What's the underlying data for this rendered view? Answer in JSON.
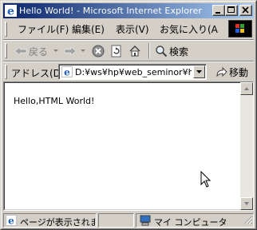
{
  "window": {
    "title": "Hello World! - Microsoft Internet Explorer"
  },
  "menu": {
    "items": [
      "ファイル(F)",
      "編集(E)",
      "表示(V)",
      "お気に入り(A"
    ]
  },
  "toolbar": {
    "back_label": "戻る",
    "search_label": "検索"
  },
  "address": {
    "label": "アドレス(D)",
    "value": "D:¥ws¥hp¥web_seminor¥html",
    "go_label": "移動"
  },
  "content": {
    "text": "Hello,HTML World!"
  },
  "status": {
    "message": "ページが表示されま",
    "zone": "マイ コンピュータ"
  },
  "colors": {
    "title_start": "#0a246a",
    "title_end": "#a6caf0",
    "face": "#d4d0c8"
  }
}
